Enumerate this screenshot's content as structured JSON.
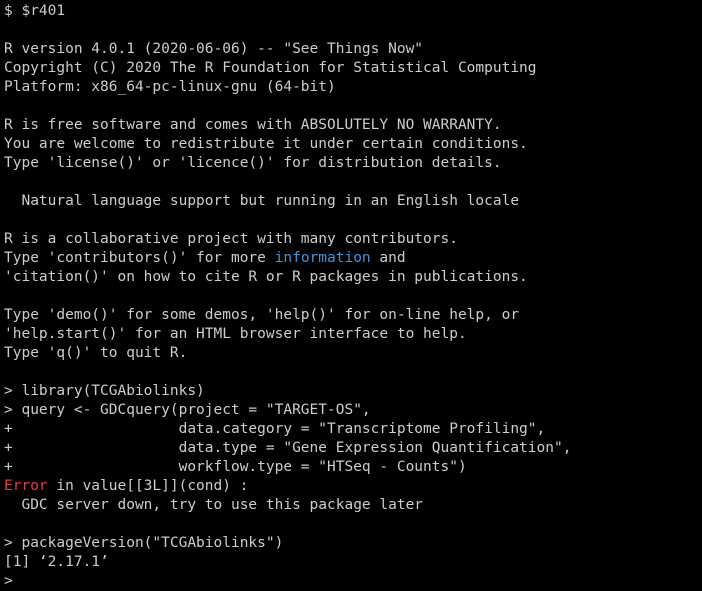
{
  "terminal": {
    "prompt_symbol": "$",
    "command": " $r401",
    "banner": {
      "line1": "R version 4.0.1 (2020-06-06) -- \"See Things Now\"",
      "line2": "Copyright (C) 2020 The R Foundation for Statistical Computing",
      "line3": "Platform: x86_64-pc-linux-gnu (64-bit)",
      "line4": "R is free software and comes with ABSOLUTELY NO WARRANTY.",
      "line5": "You are welcome to redistribute it under certain conditions.",
      "line6": "Type 'license()' or 'licence()' for distribution details.",
      "line7": "  Natural language support but running in an English locale",
      "line8": "R is a collaborative project with many contributors.",
      "line9_pre": "Type 'contributors()' for more ",
      "line9_link": "information",
      "line9_post": " and",
      "line10": "'citation()' on how to cite R or R packages in publications.",
      "line11": "Type 'demo()' for some demos, 'help()' for on-line help, or",
      "line12": "'help.start()' for an HTML browser interface to help.",
      "line13": "Type 'q()' to quit R."
    },
    "session": {
      "cmd1": "> library(TCGAbiolinks)",
      "cmd2": "> query <- GDCquery(project = \"TARGET-OS\",",
      "cmd3": "+                   data.category = \"Transcriptome Profiling\",",
      "cmd4": "+                   data.type = \"Gene Expression Quantification\",",
      "cmd5": "+                   workflow.type = \"HTSeq - Counts\")",
      "error_word": "Error",
      "error_rest": " in value[[3L]](cond) :",
      "error_msg": "  GDC server down, try to use this package later",
      "cmd6": "> packageVersion(\"TCGAbiolinks\")",
      "output": "[1] ‘2.17.1’",
      "final_prompt": ">"
    },
    "colors": {
      "background": "#000000",
      "text": "#cccccc",
      "error": "#e04040",
      "link": "#3a96dd"
    }
  }
}
